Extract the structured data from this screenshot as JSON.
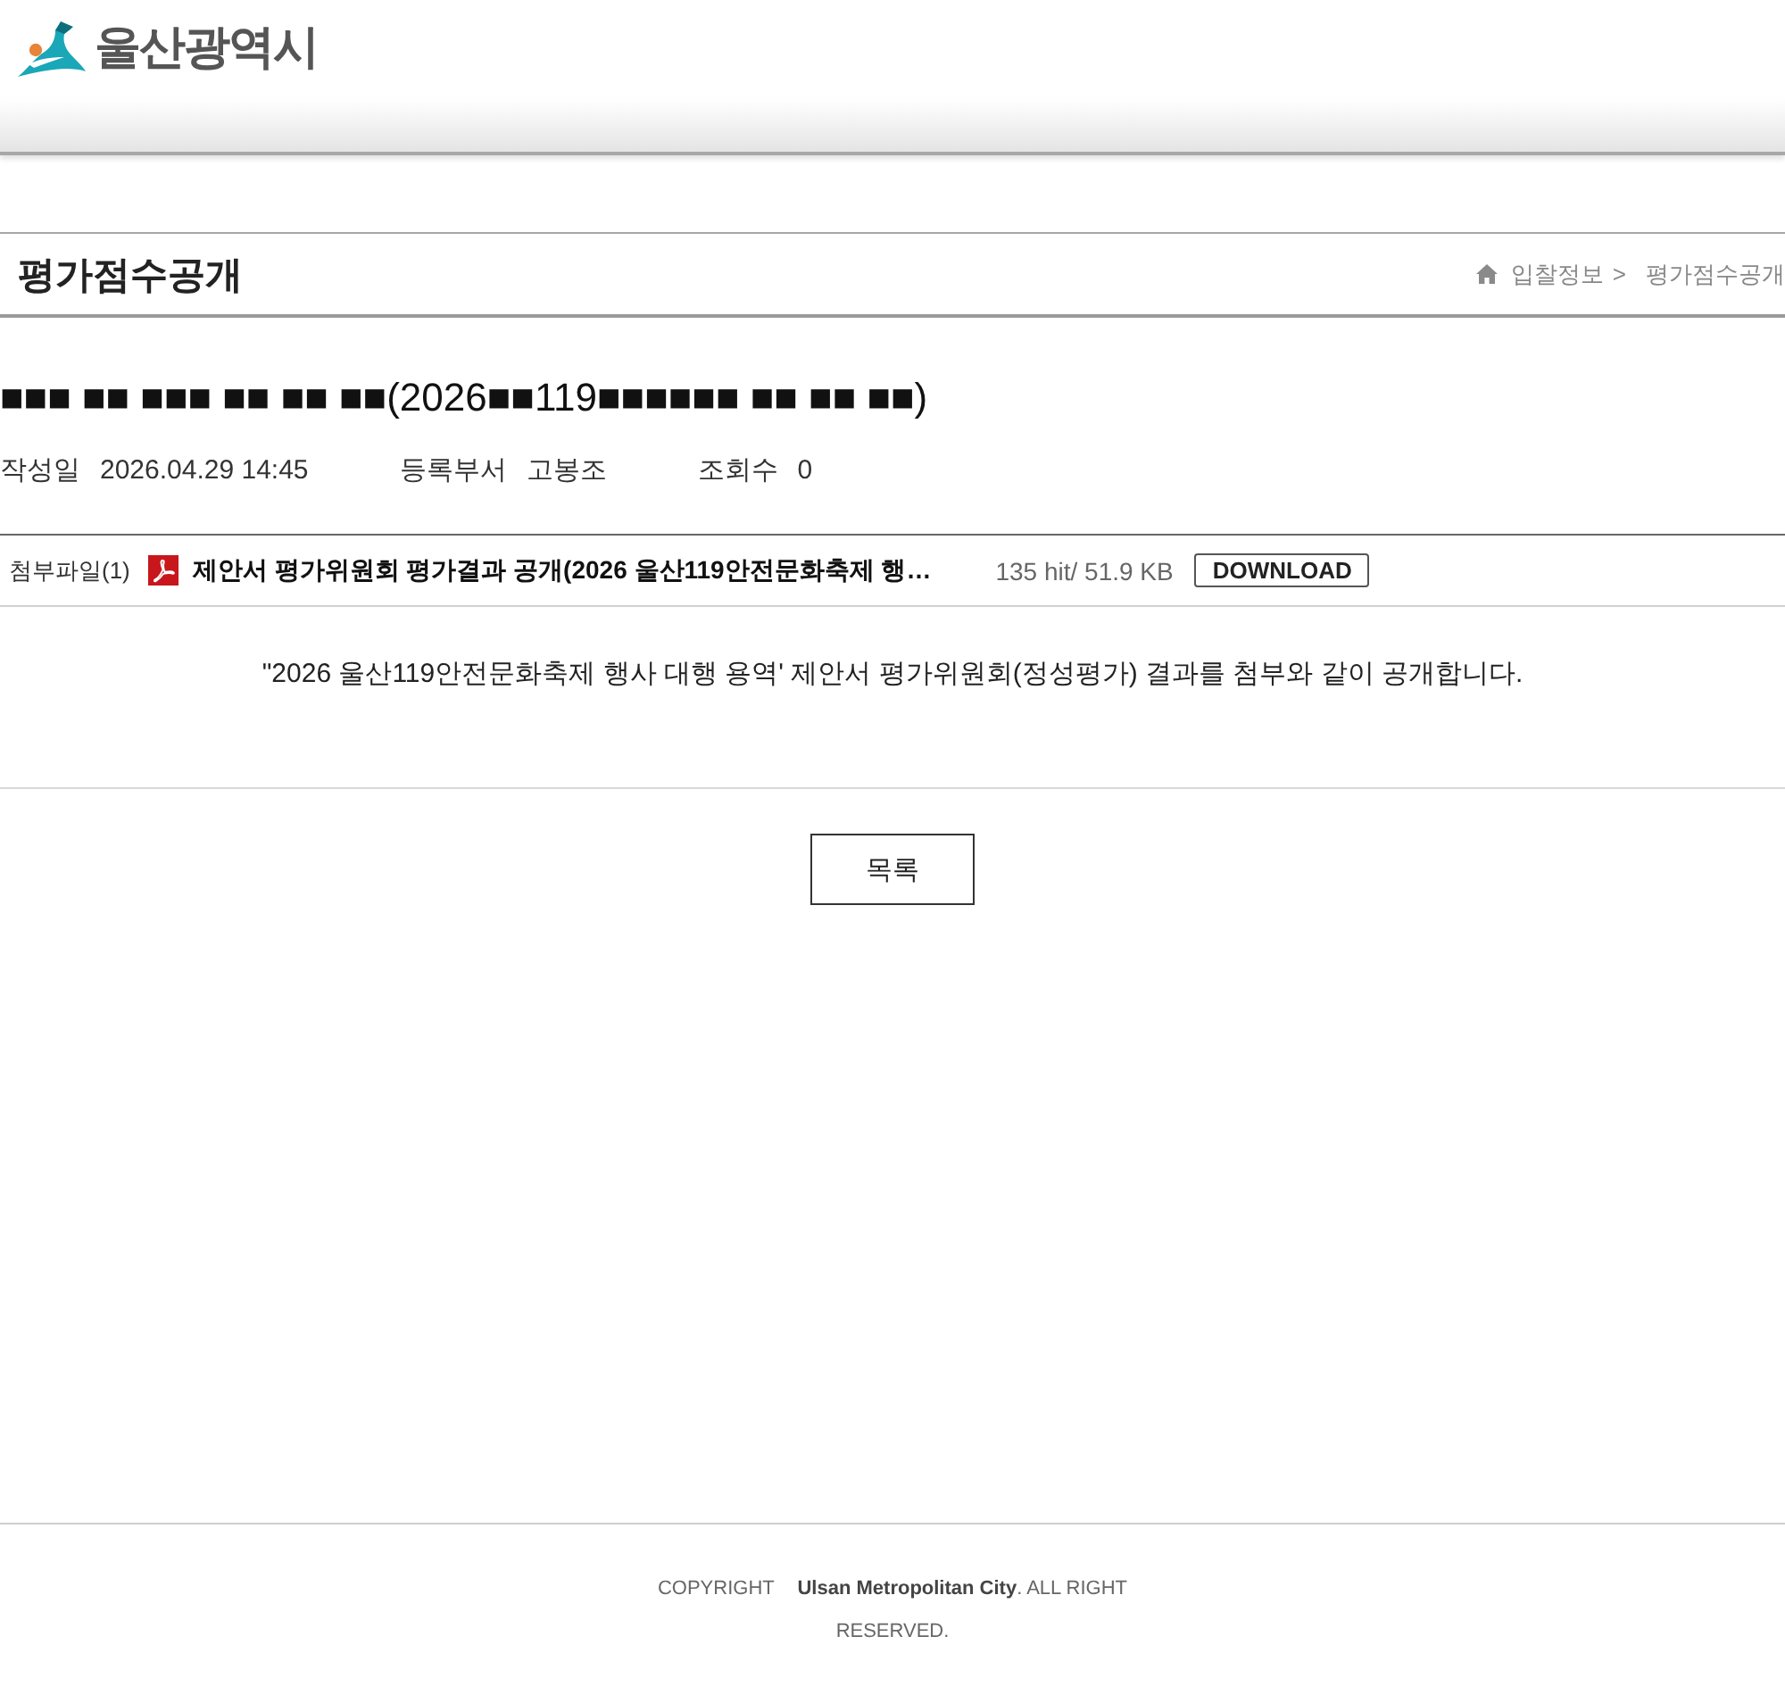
{
  "header": {
    "logo_text": "울산광역시"
  },
  "page_title": "평가점수공개",
  "breadcrumb": {
    "items": [
      "입찰정보",
      "평가점수공개"
    ],
    "separator": ">"
  },
  "post": {
    "title": "■■■ ■■ ■■■ ■■ ■■ ■■(2026■■119■■■■■■ ■■ ■■ ■■)",
    "meta": [
      {
        "label": "작성일",
        "value": "2026.04.29 14:45"
      },
      {
        "label": "등록부서",
        "value": "고봉조"
      },
      {
        "label": "조회수",
        "value": "0"
      }
    ],
    "attachments": {
      "label": "첨부파일(1)",
      "files": [
        {
          "kind": "pdf",
          "name": "제안서 평가위원회 평가결과 공개(2026 울산119안전문화축제 행…",
          "info": "135 hit/ 51.9 KB",
          "button": "DOWNLOAD"
        }
      ]
    },
    "body": "\"2026 울산119안전문화축제 행사 대행 용역' 제안서 평가위원회(정성평가) 결과를 첨부와 같이 공개합니다."
  },
  "list_button": "목록",
  "footer": {
    "copyright": "COPYRIGHT **Ulsan Metropolitan City**. ALL RIGHT RESERVED."
  }
}
